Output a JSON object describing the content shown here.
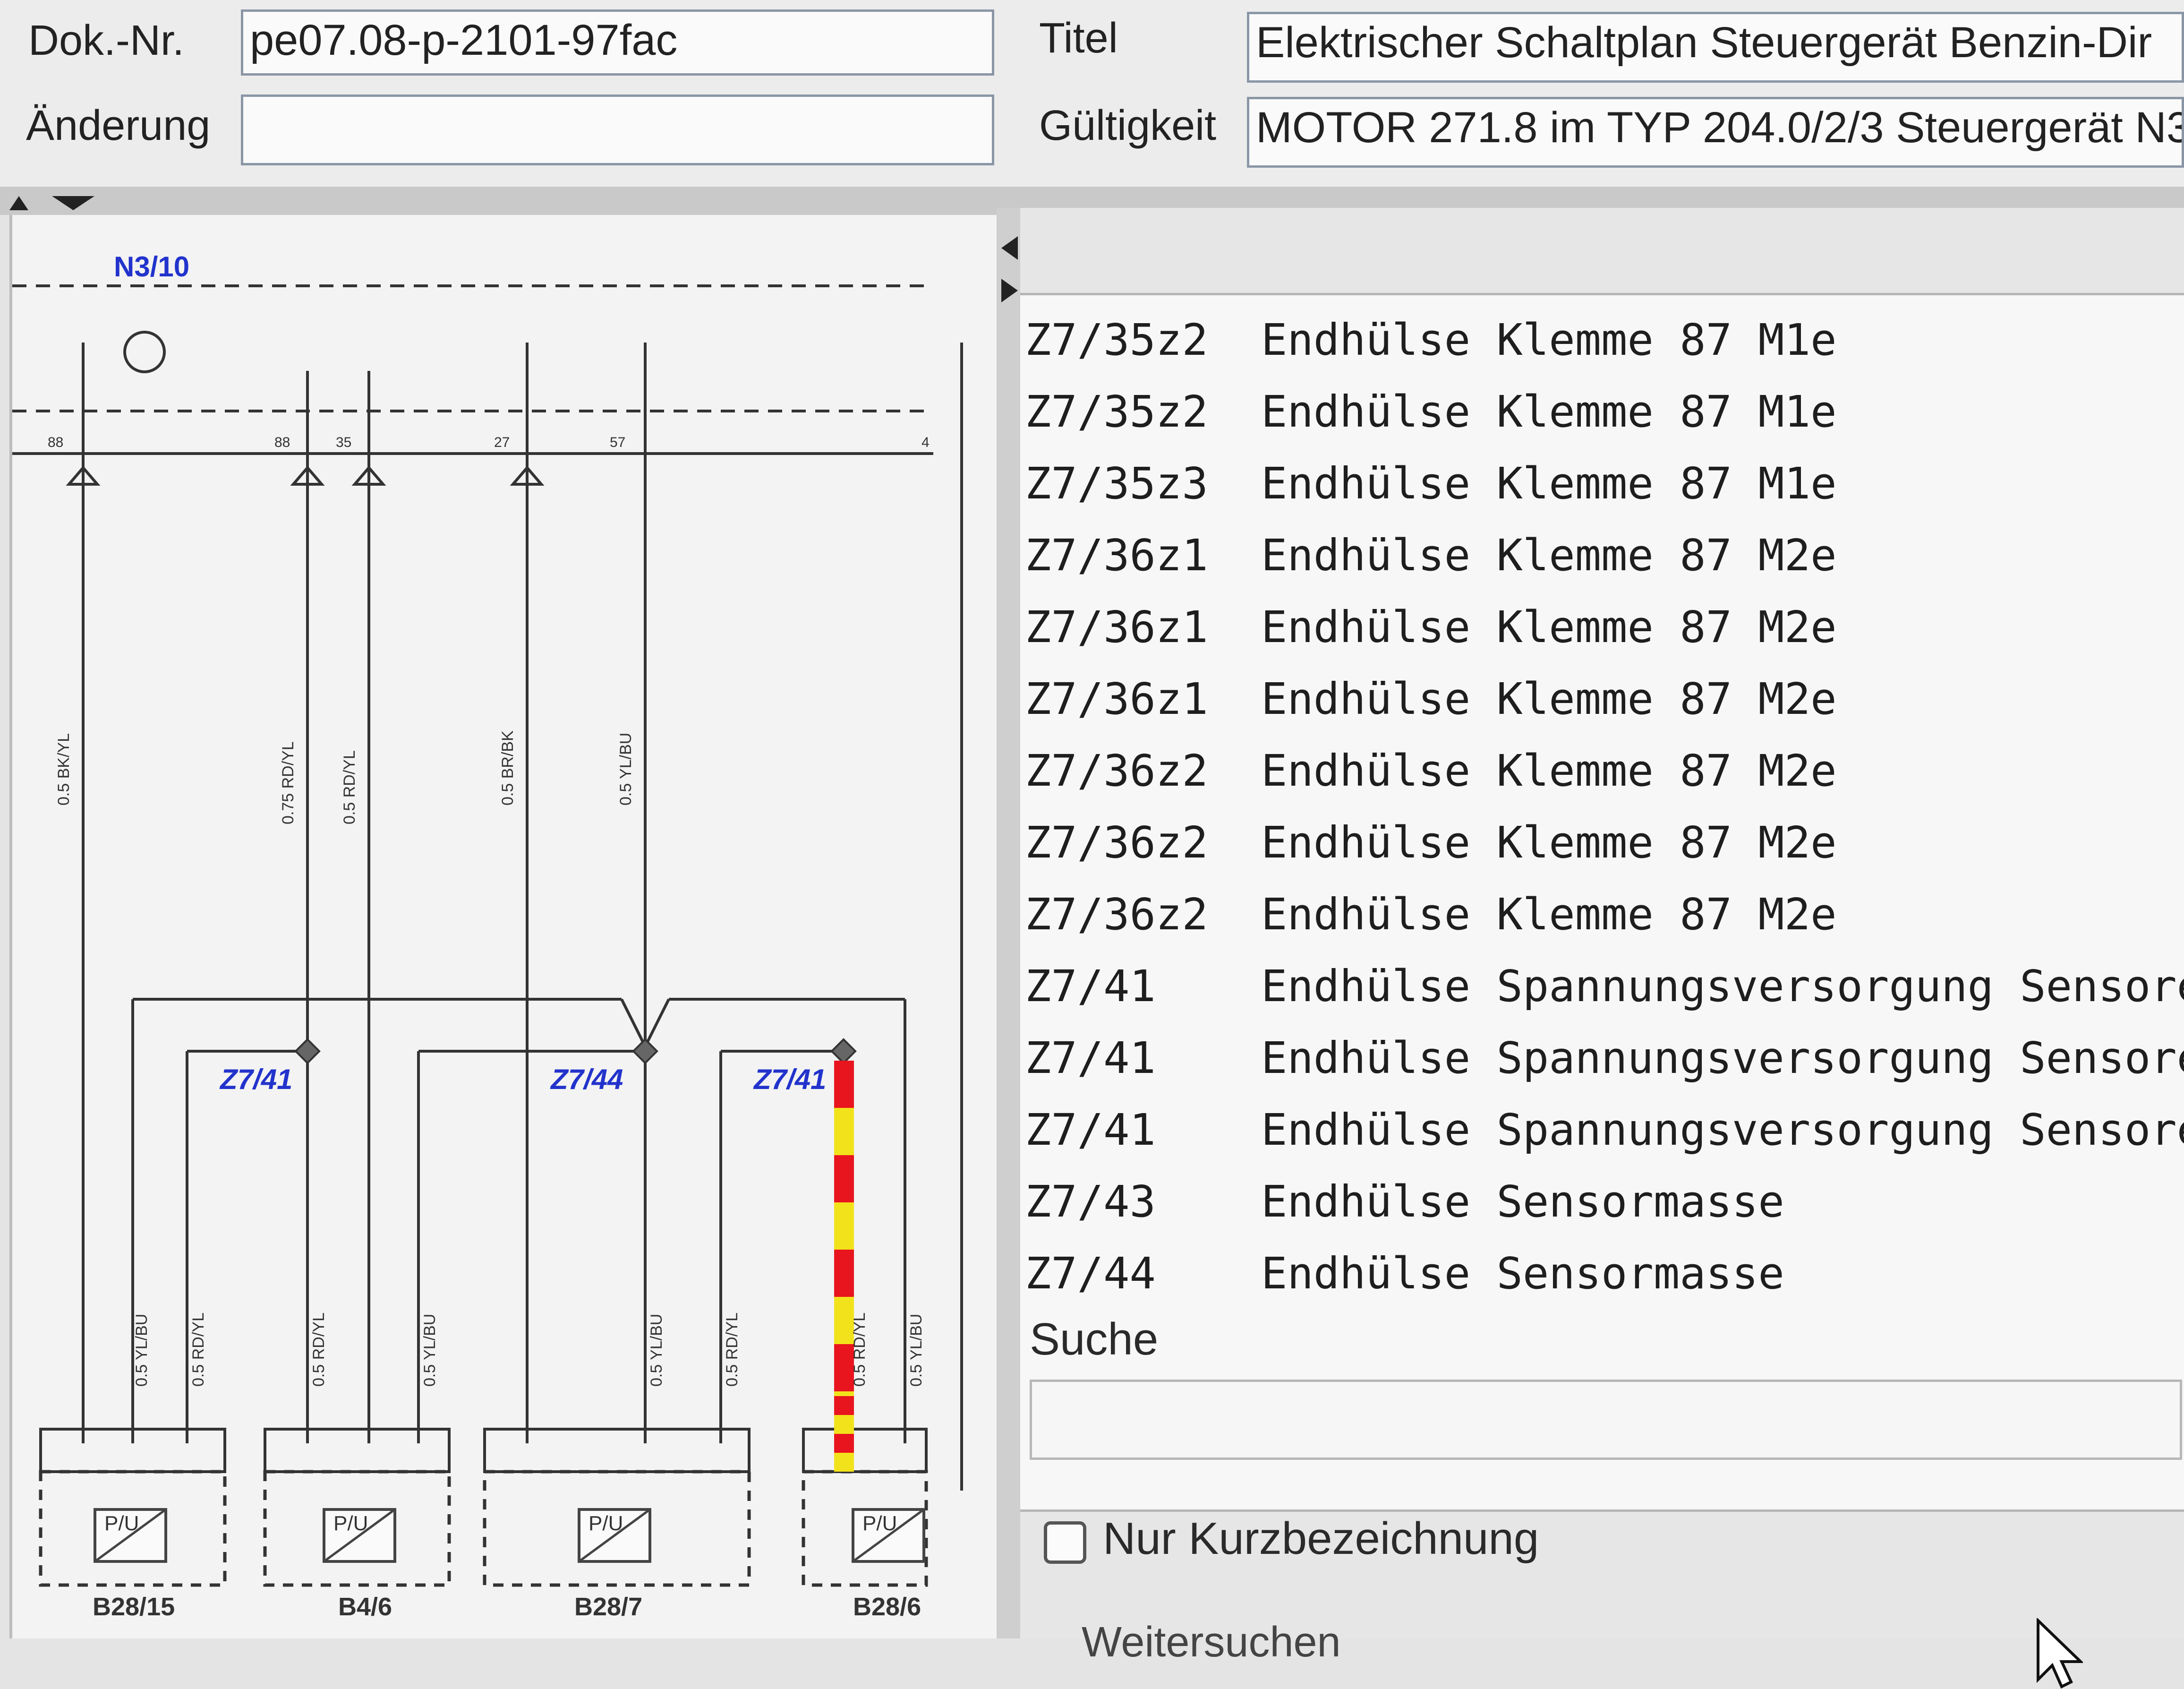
{
  "header": {
    "doknr_label": "Dok.-Nr.",
    "doknr_value": "pe07.08-p-2101-97fac",
    "aenderung_label": "Änderung",
    "aenderung_value": "",
    "titel_label": "Titel",
    "titel_value": "Elektrischer Schaltplan Steuergerät Benzin-Dir",
    "gueltigkeit_label": "Gültigkeit",
    "gueltigkeit_value": "MOTOR 271.8 im TYP 204.0/2/3 Steuergerät N3"
  },
  "schematic": {
    "module_label": "N3/10",
    "top_pins": [
      "88",
      "88",
      "35",
      "27",
      "57",
      "4"
    ],
    "top_wires": [
      "0.5 BK/YL",
      "0.75 RD/YL",
      "0.5 RD/YL",
      "0.5 BR/BK",
      "0.5 YL/BU"
    ],
    "splices": [
      "Z7/41",
      "Z7/44",
      "Z7/41"
    ],
    "bottom_wires": [
      "0.5 YL/BU",
      "0.5 RD/YL",
      "0.5 RD/YL",
      "0.5 YL/BU",
      "0.5 YL/BU",
      "0.5 RD/YL",
      "0.5 RD/YL",
      "0.5 YL/BU"
    ],
    "components": [
      "B28/15",
      "B4/6",
      "B28/7",
      "B28/6"
    ],
    "component_symbol": "P/U",
    "highlight_colors": [
      "#e8141e",
      "#f2e21c"
    ]
  },
  "list": {
    "rows": [
      {
        "code": "Z7/35z2",
        "desc": "Endhülse Klemme 87 M1e"
      },
      {
        "code": "Z7/35z2",
        "desc": "Endhülse Klemme 87 M1e"
      },
      {
        "code": "Z7/35z3",
        "desc": "Endhülse Klemme 87 M1e"
      },
      {
        "code": "Z7/36z1",
        "desc": "Endhülse Klemme 87 M2e"
      },
      {
        "code": "Z7/36z1",
        "desc": "Endhülse Klemme 87 M2e"
      },
      {
        "code": "Z7/36z1",
        "desc": "Endhülse Klemme 87 M2e"
      },
      {
        "code": "Z7/36z2",
        "desc": "Endhülse Klemme 87 M2e"
      },
      {
        "code": "Z7/36z2",
        "desc": "Endhülse Klemme 87 M2e"
      },
      {
        "code": "Z7/36z2",
        "desc": "Endhülse Klemme 87 M2e"
      },
      {
        "code": "Z7/41",
        "desc": "Endhülse Spannungsversorgung Sensore"
      },
      {
        "code": "Z7/41",
        "desc": "Endhülse Spannungsversorgung Sensore"
      },
      {
        "code": "Z7/41",
        "desc": "Endhülse Spannungsversorgung Sensore"
      },
      {
        "code": "Z7/43",
        "desc": "Endhülse Sensormasse"
      },
      {
        "code": "Z7/44",
        "desc": "Endhülse Sensormasse"
      }
    ]
  },
  "search": {
    "label": "Suche",
    "value": "",
    "short_name_checkbox_label": "Nur Kurzbezeichnung",
    "short_name_checked": false,
    "continue_label": "Weitersuchen"
  }
}
